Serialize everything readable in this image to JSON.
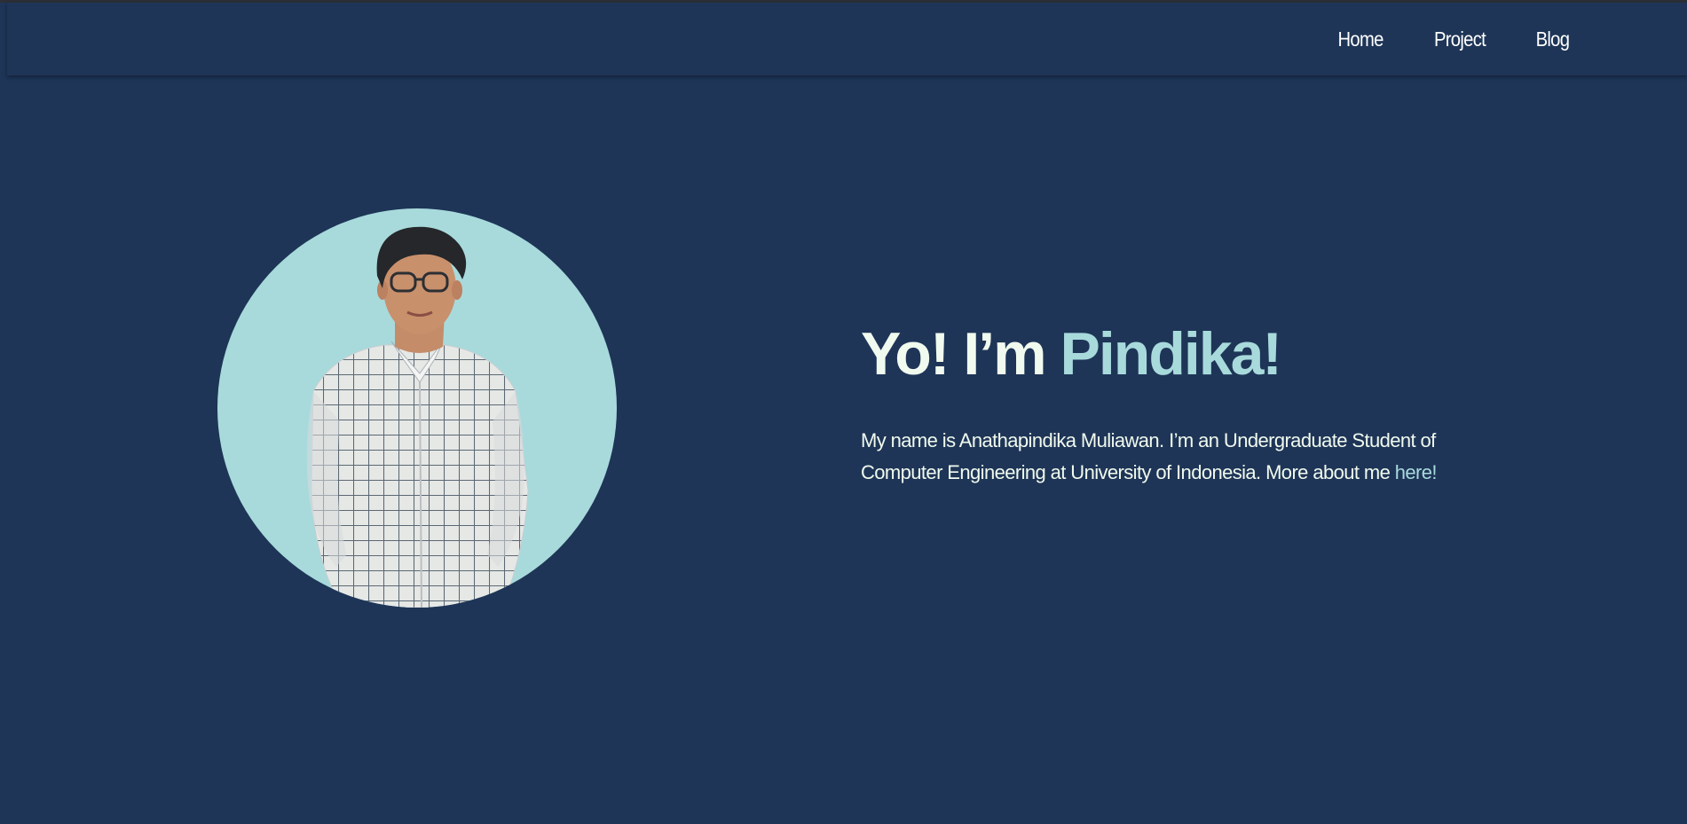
{
  "nav": {
    "items": [
      {
        "label": "Home"
      },
      {
        "label": "Project"
      },
      {
        "label": "Blog"
      }
    ]
  },
  "hero": {
    "headline_prefix": "Yo! I’m ",
    "headline_name": "Pindika!",
    "intro_text": "My name is Anathapindika Muliawan. I’m an Undergraduate Student of Computer Engineering at University of Indonesia. More about me ",
    "intro_link": "here!"
  },
  "colors": {
    "background": "#1e3557",
    "accent": "#a8dadc",
    "text": "#f1faee"
  },
  "icons": {
    "portrait": "profile-photo"
  }
}
